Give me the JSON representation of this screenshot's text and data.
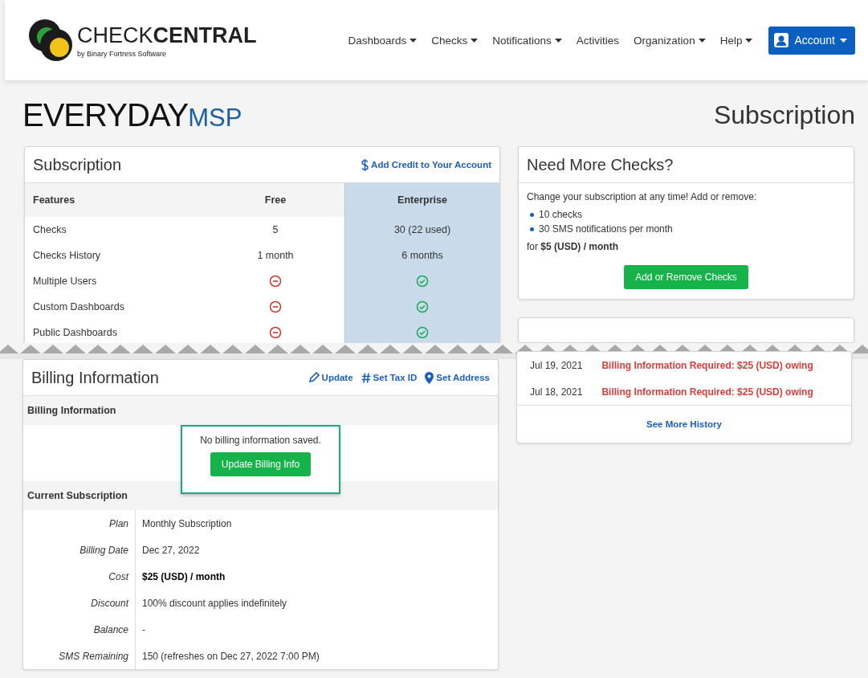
{
  "header": {
    "logo": {
      "light": "CHECK",
      "bold": "CENTRAL",
      "tagline": "by Binary Fortress Software"
    },
    "nav": [
      {
        "label": "Dashboards",
        "dropdown": true
      },
      {
        "label": "Checks",
        "dropdown": true
      },
      {
        "label": "Notifications",
        "dropdown": true
      },
      {
        "label": "Activities",
        "dropdown": false
      },
      {
        "label": "Organization",
        "dropdown": true
      },
      {
        "label": "Help",
        "dropdown": true
      }
    ],
    "account_button": {
      "label": "Account"
    }
  },
  "brand": {
    "light": "EVERYDAY",
    "bold": "MSP"
  },
  "page_title": "Subscription",
  "subscription_card": {
    "title": "Subscription",
    "action": "Add Credit to Your Account",
    "columns": [
      {
        "label": "Features",
        "selected": false
      },
      {
        "label": "Free",
        "selected": false
      },
      {
        "label": "Enterprise",
        "selected": true
      }
    ],
    "rows": [
      {
        "cells": [
          {
            "kind": "text",
            "text": "Checks"
          },
          {
            "kind": "text",
            "text": "5"
          },
          {
            "kind": "text",
            "text": "30 (22 used)"
          }
        ]
      },
      {
        "cells": [
          {
            "kind": "text",
            "text": "Checks History"
          },
          {
            "kind": "text",
            "text": "1 month"
          },
          {
            "kind": "text",
            "text": "6 months"
          }
        ]
      },
      {
        "cells": [
          {
            "kind": "text",
            "text": "Multiple Users"
          },
          {
            "kind": "no"
          },
          {
            "kind": "yes"
          }
        ]
      },
      {
        "cells": [
          {
            "kind": "text",
            "text": "Custom Dashboards"
          },
          {
            "kind": "no"
          },
          {
            "kind": "yes"
          }
        ]
      },
      {
        "cells": [
          {
            "kind": "text",
            "text": "Public Dashboards"
          },
          {
            "kind": "no"
          },
          {
            "kind": "yes"
          }
        ]
      }
    ]
  },
  "more_checks_card": {
    "title": "Need More Checks?",
    "intro": "Change your subscription at any time! Add or remove:",
    "bullets": [
      "10 checks",
      "30 SMS notifications per month"
    ],
    "price": "for **$5 (USD) / month**",
    "button": "Add or Remove Checks"
  },
  "history_card": {
    "rows": [
      {
        "date": "Jul 19, 2021",
        "message": "Billing Information Required: $25 (USD) owing"
      },
      {
        "date": "Jul 18, 2021",
        "message": "Billing Information Required: $25 (USD) owing"
      }
    ],
    "footer_link": "See More History"
  },
  "billing_card": {
    "title": "Billing Information",
    "actions": [
      "Update",
      "Set Tax ID",
      "Set Address"
    ],
    "billing_section": {
      "heading": "Billing Information",
      "message": "No billing information saved.",
      "button": "Update Billing Info",
      "highlighted": true
    },
    "subscription_section": {
      "heading": "Current Subscription",
      "details": [
        {
          "label": "Plan",
          "value": "Monthly Subscription",
          "bold": false
        },
        {
          "label": "Billing Date",
          "value": "Dec 27, 2022",
          "bold": false
        },
        {
          "label": "Cost",
          "value": "$25 (USD) / month",
          "bold": true
        },
        {
          "label": "Discount",
          "value": "100% discount applies indefinitely",
          "bold": false
        },
        {
          "label": "Balance",
          "value": "-",
          "bold": false
        },
        {
          "label": "SMS Remaining",
          "value": "150 (refreshes on Dec 27, 2022 7:00 PM)",
          "bold": false
        }
      ]
    }
  }
}
